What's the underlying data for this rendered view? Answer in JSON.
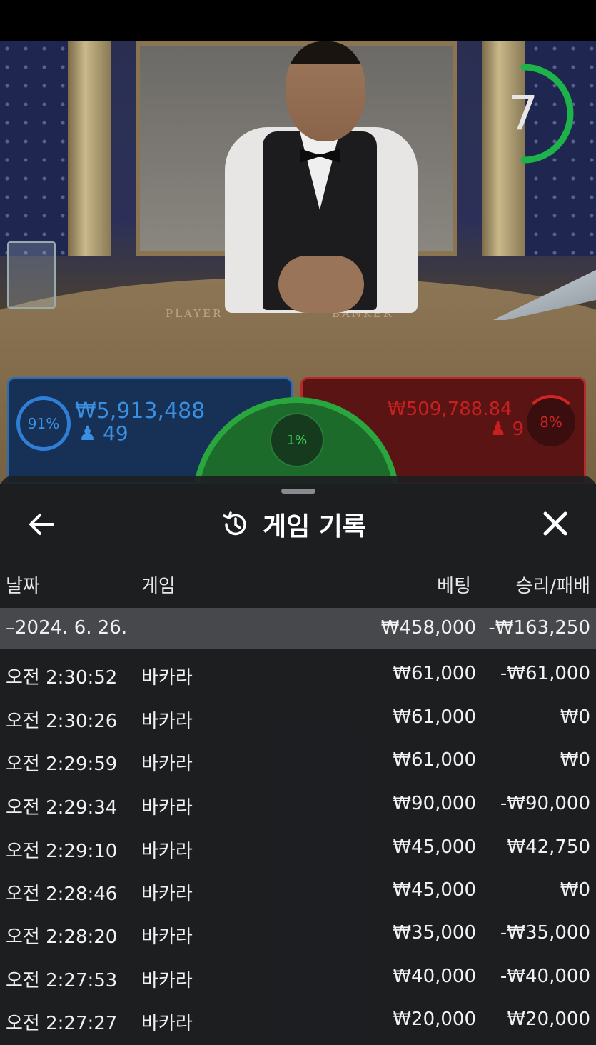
{
  "scene": {
    "timer_value": "7",
    "felt_player": "PLAYER",
    "felt_banker": "BANKER"
  },
  "bets": {
    "player": {
      "percent": "91%",
      "percent_value": 91,
      "amount": "₩5,913,488",
      "players": "49",
      "color": "#2f6cb8"
    },
    "tie": {
      "percent": "1%",
      "percent_value": 1,
      "color": "#2aa63e"
    },
    "banker": {
      "percent": "8%",
      "percent_value": 8,
      "amount": "₩509,788.84",
      "players": "9",
      "color": "#b82a2a"
    }
  },
  "sheet": {
    "title": "게임 기록",
    "icons": {
      "back": "arrow-left-icon",
      "history": "history-icon",
      "close": "close-icon"
    },
    "columns": {
      "date": "날짜",
      "game": "게임",
      "bet": "베팅",
      "result": "승리/패배"
    },
    "summary": {
      "date": "–2024. 6. 26.",
      "bet": "₩458,000",
      "result": "-₩163,250"
    },
    "rows": [
      {
        "time": "오전 2:30:52",
        "game": "바카라",
        "bet": "₩61,000",
        "result": "-₩61,000"
      },
      {
        "time": "오전 2:30:26",
        "game": "바카라",
        "bet": "₩61,000",
        "result": "₩0"
      },
      {
        "time": "오전 2:29:59",
        "game": "바카라",
        "bet": "₩61,000",
        "result": "₩0"
      },
      {
        "time": "오전 2:29:34",
        "game": "바카라",
        "bet": "₩90,000",
        "result": "-₩90,000"
      },
      {
        "time": "오전 2:29:10",
        "game": "바카라",
        "bet": "₩45,000",
        "result": "₩42,750"
      },
      {
        "time": "오전 2:28:46",
        "game": "바카라",
        "bet": "₩45,000",
        "result": "₩0"
      },
      {
        "time": "오전 2:28:20",
        "game": "바카라",
        "bet": "₩35,000",
        "result": "-₩35,000"
      },
      {
        "time": "오전 2:27:53",
        "game": "바카라",
        "bet": "₩40,000",
        "result": "-₩40,000"
      },
      {
        "time": "오전 2:27:27",
        "game": "바카라",
        "bet": "₩20,000",
        "result": "₩20,000"
      }
    ]
  }
}
